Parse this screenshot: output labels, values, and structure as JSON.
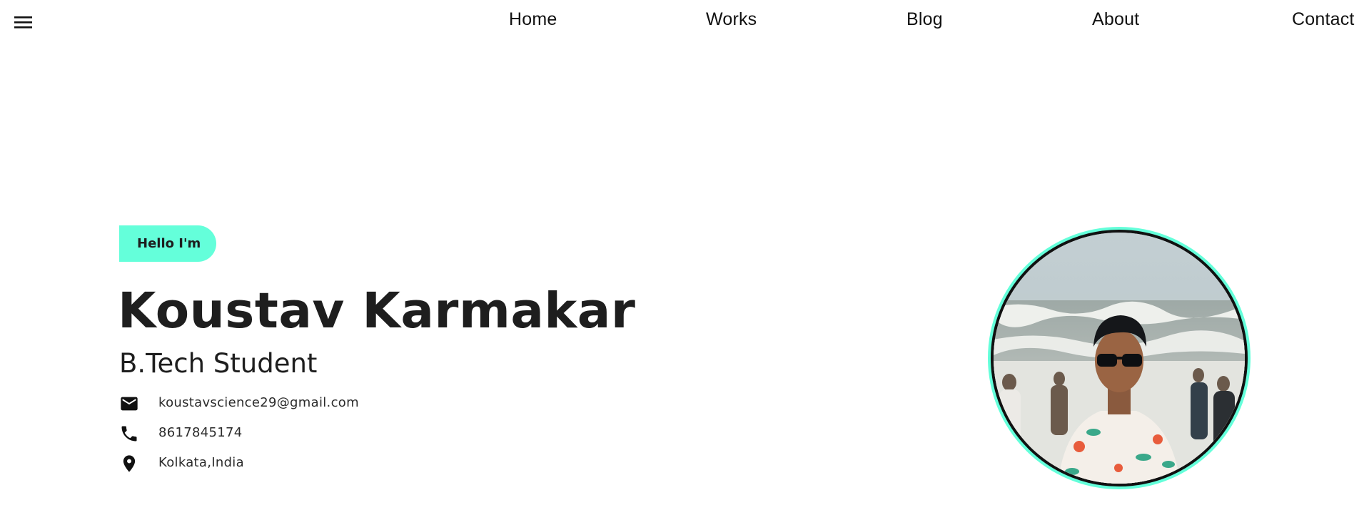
{
  "nav": {
    "menu_icon": "hamburger-menu-icon",
    "links": [
      {
        "label": "Home"
      },
      {
        "label": "Works"
      },
      {
        "label": "Blog"
      },
      {
        "label": "About"
      },
      {
        "label": "Contact"
      }
    ]
  },
  "hero": {
    "greeting": "Hello I'm",
    "name": "Koustav Karmakar",
    "role": "B.Tech Student",
    "contacts": [
      {
        "icon": "mail-icon",
        "text": "koustavscience29@gmail.com"
      },
      {
        "icon": "phone-icon",
        "text": "8617845174"
      },
      {
        "icon": "location-pin-icon",
        "text": "Kolkata,India"
      }
    ]
  },
  "colors": {
    "accent": "#64ffda",
    "text": "#1e1e1e",
    "background": "#ffffff"
  }
}
